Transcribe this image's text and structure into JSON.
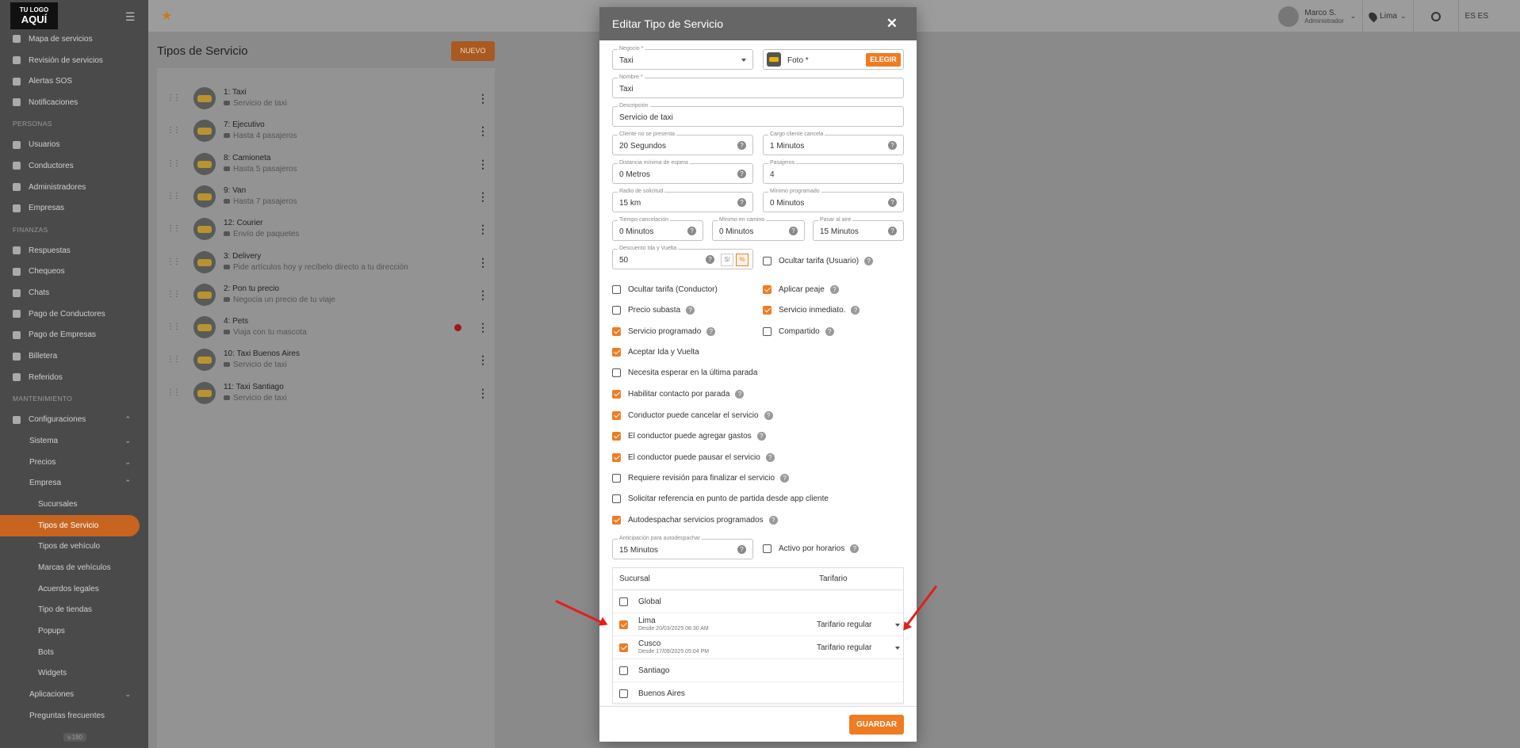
{
  "sidebar": {
    "logo_small": "TU LOGO",
    "logo_big": "AQUÍ",
    "items": [
      {
        "label": "Mapa de servicios",
        "type": "item"
      },
      {
        "label": "Revisión de servicios",
        "type": "item"
      },
      {
        "label": "Alertas SOS",
        "type": "item"
      },
      {
        "label": "Notificaciones",
        "type": "item"
      },
      {
        "label": "PERSONAS",
        "type": "section"
      },
      {
        "label": "Usuarios",
        "type": "item"
      },
      {
        "label": "Conductores",
        "type": "item"
      },
      {
        "label": "Administradores",
        "type": "item"
      },
      {
        "label": "Empresas",
        "type": "item"
      },
      {
        "label": "FINANZAS",
        "type": "section"
      },
      {
        "label": "Respuestas",
        "type": "item"
      },
      {
        "label": "Chequeos",
        "type": "item"
      },
      {
        "label": "Chats",
        "type": "item"
      },
      {
        "label": "Pago de Conductores",
        "type": "item"
      },
      {
        "label": "Pago de Empresas",
        "type": "item"
      },
      {
        "label": "Billetera",
        "type": "item"
      },
      {
        "label": "Referidos",
        "type": "item"
      },
      {
        "label": "MANTENIMIENTO",
        "type": "section"
      },
      {
        "label": "Configuraciones",
        "type": "item",
        "chev": "⌃"
      },
      {
        "label": "Sistema",
        "type": "sub",
        "chev": "⌄"
      },
      {
        "label": "Precios",
        "type": "sub",
        "chev": "⌄"
      },
      {
        "label": "Empresa",
        "type": "sub",
        "chev": "⌃"
      },
      {
        "label": "Sucursales",
        "type": "sub2"
      },
      {
        "label": "Tipos de Servicio",
        "type": "sub2",
        "active": true
      },
      {
        "label": "Tipos de vehículo",
        "type": "sub2"
      },
      {
        "label": "Marcas de vehículos",
        "type": "sub2"
      },
      {
        "label": "Acuerdos legales",
        "type": "sub2"
      },
      {
        "label": "Tipo de tiendas",
        "type": "sub2"
      },
      {
        "label": "Popups",
        "type": "sub2"
      },
      {
        "label": "Bots",
        "type": "sub2"
      },
      {
        "label": "Widgets",
        "type": "sub2"
      },
      {
        "label": "Aplicaciones",
        "type": "sub",
        "chev": "⌄"
      },
      {
        "label": "Preguntas frecuentes",
        "type": "sub"
      }
    ],
    "version": "v.180"
  },
  "topbar": {
    "user_name": "Marco S.",
    "user_role": "Administrador",
    "location": "Lima",
    "language": "ES ES"
  },
  "content": {
    "title": "Tipos de Servicio",
    "new_button": "NUEVO",
    "services": [
      {
        "name": "1: Taxi",
        "desc": "Servicio de taxi"
      },
      {
        "name": "7: Ejecutivo",
        "desc": "Hasta 4 pasajeros"
      },
      {
        "name": "8: Camioneta",
        "desc": "Hasta 5 pasajeros"
      },
      {
        "name": "9: Van",
        "desc": "Hasta 7 pasajeros"
      },
      {
        "name": "12: Courier",
        "desc": "Envío de paquetes"
      },
      {
        "name": "3: Delivery",
        "desc": "Pide artículos hoy y recíbelo directo a tu dirección"
      },
      {
        "name": "2: Pon tu precio",
        "desc": "Negocia un precio de tu viaje"
      },
      {
        "name": "4: Pets",
        "desc": "Viaja con tu mascota",
        "badge": true
      },
      {
        "name": "10: Taxi Buenos Aires",
        "desc": "Servicio de taxi"
      },
      {
        "name": "11: Taxi Santiago",
        "desc": "Servicio de taxi"
      }
    ]
  },
  "modal": {
    "title": "Editar Tipo de Servicio",
    "fields": {
      "negocio": {
        "label": "Negocio *",
        "value": "Taxi"
      },
      "foto": {
        "label": "Foto *",
        "button": "ELEGIR"
      },
      "nombre": {
        "label": "Nombre *",
        "value": "Taxi"
      },
      "descripcion": {
        "label": "Descripción",
        "value": "Servicio de taxi"
      },
      "cliente_no_presenta": {
        "label": "Cliente no se presenta",
        "value": "20 Segundos"
      },
      "cargo_cliente_cancela": {
        "label": "Cargo cliente cancela",
        "value": "1 Minutos"
      },
      "distancia_minima": {
        "label": "Distancia mínima de espera",
        "value": "0 Metros"
      },
      "pasajeros": {
        "label": "Pasajeros",
        "value": "4"
      },
      "radio_solicitud": {
        "label": "Radio de solicitud",
        "value": "15 km"
      },
      "minimo_programado": {
        "label": "Mínimo programado",
        "value": "0 Minutos"
      },
      "tiempo_cancelacion": {
        "label": "Tiempo cancelación",
        "value": "0 Minutos"
      },
      "minimo_en_camino": {
        "label": "Mínimo en camino",
        "value": "0 Minutos"
      },
      "pasar_al_aire": {
        "label": "Pasar al aire",
        "value": "15 Minutos"
      },
      "descuento_ida_vuelta": {
        "label": "Descuento Ida y Vuelta",
        "value": "50",
        "unit_a": "S/",
        "unit_b": "%"
      },
      "anticipacion": {
        "label": "Anticipación para autodespachar",
        "value": "15 Minutos"
      }
    },
    "checkboxes": [
      {
        "label": "Ocultar tarifa (Usuario)",
        "checked": false,
        "help": true
      },
      {
        "label": "Ocultar tarifa (Conductor)",
        "checked": false,
        "help": false
      },
      {
        "label": "Aplicar peaje",
        "checked": true,
        "help": true
      },
      {
        "label": "Precio subasta",
        "checked": false,
        "help": true
      },
      {
        "label": "Servicio inmediato.",
        "checked": true,
        "help": true
      },
      {
        "label": "Servicio programado",
        "checked": true,
        "help": true
      },
      {
        "label": "Compartido",
        "checked": false,
        "help": true
      },
      {
        "label": "Aceptar Ida y Vuelta",
        "checked": true,
        "help": false
      },
      {
        "label": "Necesita esperar en la última parada",
        "checked": false,
        "help": false
      },
      {
        "label": "Habilitar contacto por parada",
        "checked": true,
        "help": true
      },
      {
        "label": "Conductor puede cancelar el servicio",
        "checked": true,
        "help": true
      },
      {
        "label": "El conductor puede agregar gastos",
        "checked": true,
        "help": true
      },
      {
        "label": "El conductor puede pausar el servicio",
        "checked": true,
        "help": true
      },
      {
        "label": "Requiere revisión para finalizar el servicio",
        "checked": false,
        "help": true
      },
      {
        "label": "Solicitar referencia en punto de partida desde app cliente",
        "checked": false,
        "help": false
      },
      {
        "label": "Autodespachar servicios programados",
        "checked": true,
        "help": true
      },
      {
        "label": "Activo por horarios",
        "checked": false,
        "help": true
      }
    ],
    "branches": {
      "col_branch": "Sucursal",
      "col_tariff": "Tarifario",
      "rows": [
        {
          "name": "Global",
          "checked": false
        },
        {
          "name": "Lima",
          "checked": true,
          "since": "Desde 20/03/2025 08:30 AM",
          "tariff": "Tarifario regular"
        },
        {
          "name": "Cusco",
          "checked": true,
          "since": "Desde 17/09/2025 05:04 PM",
          "tariff": "Tarifario regular"
        },
        {
          "name": "Santiago",
          "checked": false
        },
        {
          "name": "Buenos Aires",
          "checked": false
        }
      ]
    },
    "save_button": "GUARDAR"
  },
  "colors": {
    "accent": "#ef7c22",
    "arrow": "#e01f1f",
    "overlay": "#8a8a8a"
  }
}
